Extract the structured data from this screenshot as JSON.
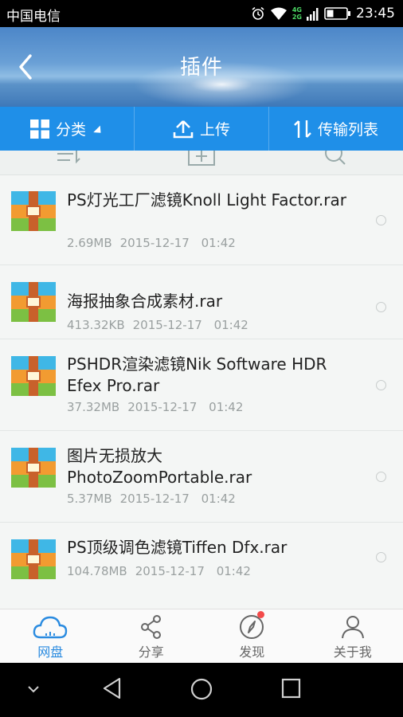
{
  "status_bar": {
    "carrier": "中国电信",
    "network_top": "4G",
    "network_bottom": "2G",
    "time": "23:45"
  },
  "header": {
    "title": "插件"
  },
  "toolbar": {
    "category_label": "分类",
    "upload_label": "上传",
    "transfer_label": "传输列表"
  },
  "files": [
    {
      "name": "PS灯光工厂滤镜Knoll Light Factor.rar",
      "size": "2.69MB",
      "date": "2015-12-17",
      "time": "01:42"
    },
    {
      "name": "海报抽象合成素材.rar",
      "size": "413.32KB",
      "date": "2015-12-17",
      "time": "01:42"
    },
    {
      "name": "PSHDR渲染滤镜Nik Software HDR Efex Pro.rar",
      "size": "37.32MB",
      "date": "2015-12-17",
      "time": "01:42"
    },
    {
      "name": "图片无损放大PhotoZoomPortable.rar",
      "size": "5.37MB",
      "date": "2015-12-17",
      "time": "01:42"
    },
    {
      "name": "PS顶级调色滤镜Tiffen Dfx.rar",
      "size": "104.78MB",
      "date": "2015-12-17",
      "time": "01:42"
    }
  ],
  "bottom_nav": {
    "items": [
      {
        "label": "网盘",
        "icon": "cloud-icon",
        "active": true
      },
      {
        "label": "分享",
        "icon": "share-icon",
        "active": false
      },
      {
        "label": "发现",
        "icon": "compass-icon",
        "active": false,
        "badge": true
      },
      {
        "label": "关于我",
        "icon": "person-icon",
        "active": false
      }
    ]
  },
  "colors": {
    "accent": "#1f8fe8",
    "active_tab": "#2a8be0",
    "badge": "#f34a4a",
    "meta_text": "#9aa0a0"
  }
}
